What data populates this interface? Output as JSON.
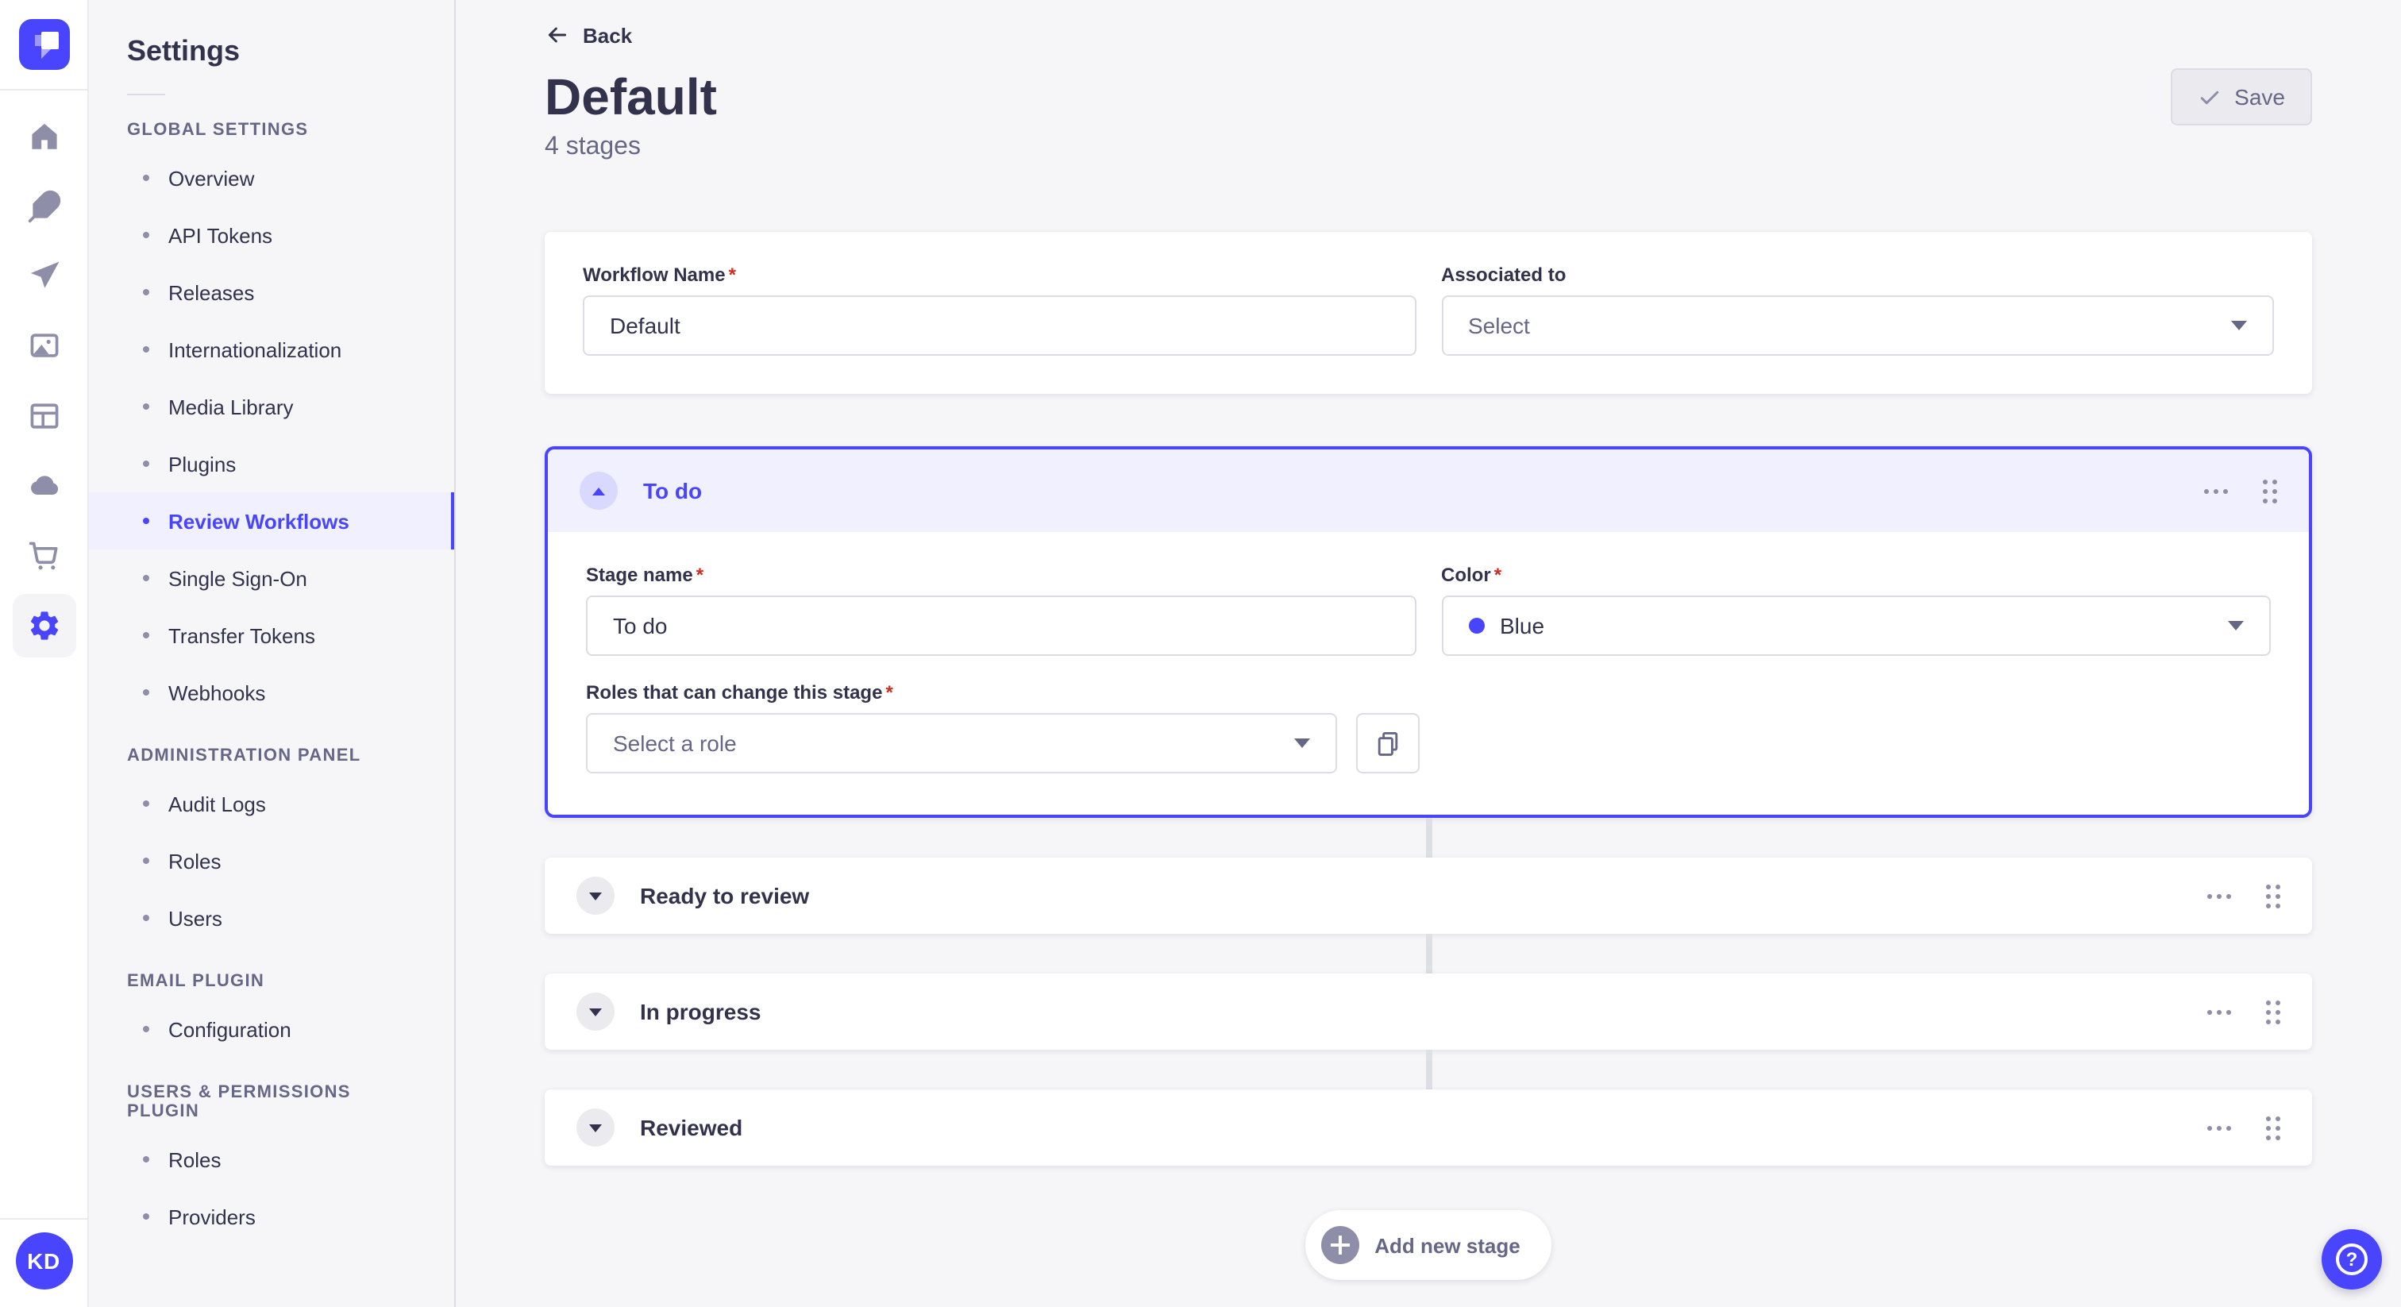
{
  "ui": {
    "required_mark": "*"
  },
  "colors": {
    "primary": "#4945FF",
    "primary_light_bg": "#F0F0FF",
    "page_bg": "#F6F6F9",
    "border": "#DCDCE4",
    "text_dark": "#32324D",
    "text_secondary": "#666687",
    "required_red": "#D02B20",
    "stage_color_hex": "#4945FF"
  },
  "rail": {
    "logo_icon": "strapi-logo-icon",
    "items": [
      {
        "icon": "home-icon"
      },
      {
        "icon": "content-feather-icon"
      },
      {
        "icon": "send-plane-icon"
      },
      {
        "icon": "media-library-icon"
      },
      {
        "icon": "content-manager-layout-icon"
      },
      {
        "icon": "cloud-icon"
      },
      {
        "icon": "marketplace-cart-icon"
      },
      {
        "icon": "settings-gear-icon",
        "active": true
      }
    ],
    "avatar_initials": "KD"
  },
  "sidebar": {
    "title": "Settings",
    "sections": [
      {
        "label": "GLOBAL SETTINGS",
        "items": [
          {
            "label": "Overview"
          },
          {
            "label": "API Tokens"
          },
          {
            "label": "Releases"
          },
          {
            "label": "Internationalization"
          },
          {
            "label": "Media Library"
          },
          {
            "label": "Plugins"
          },
          {
            "label": "Review Workflows",
            "active": true
          },
          {
            "label": "Single Sign-On"
          },
          {
            "label": "Transfer Tokens"
          },
          {
            "label": "Webhooks"
          }
        ]
      },
      {
        "label": "ADMINISTRATION PANEL",
        "items": [
          {
            "label": "Audit Logs"
          },
          {
            "label": "Roles"
          },
          {
            "label": "Users"
          }
        ]
      },
      {
        "label": "EMAIL PLUGIN",
        "items": [
          {
            "label": "Configuration"
          }
        ]
      },
      {
        "label": "USERS & PERMISSIONS PLUGIN",
        "items": [
          {
            "label": "Roles"
          },
          {
            "label": "Providers"
          }
        ]
      }
    ]
  },
  "header": {
    "back_label": "Back",
    "title": "Default",
    "subtitle": "4 stages",
    "save_label": "Save"
  },
  "workflow_form": {
    "name_label": "Workflow Name",
    "name_value": "Default",
    "associated_label": "Associated to",
    "associated_placeholder": "Select"
  },
  "stages": {
    "expanded": {
      "title": "To do",
      "stage_name_label": "Stage name",
      "stage_name_value": "To do",
      "color_label": "Color",
      "color_value": "Blue",
      "roles_label": "Roles that can change this stage",
      "roles_placeholder": "Select a role"
    },
    "collapsed": [
      {
        "title": "Ready to review"
      },
      {
        "title": "In progress"
      },
      {
        "title": "Reviewed"
      }
    ]
  },
  "footer": {
    "add_stage_label": "Add new stage",
    "help_icon": "help-question-icon"
  }
}
